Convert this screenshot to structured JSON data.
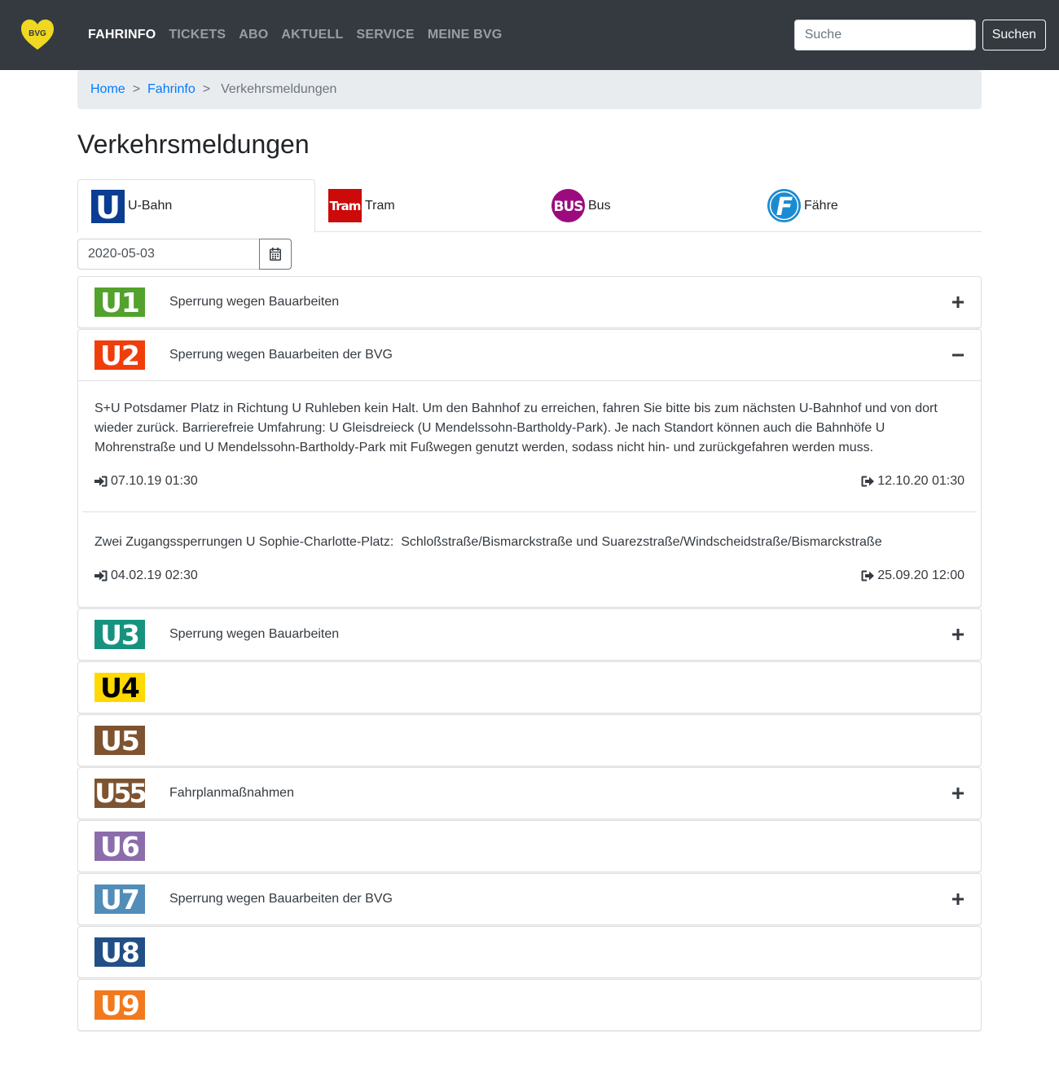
{
  "navbar": {
    "logo_text": "BVG",
    "items": [
      {
        "label": "FAHRINFO",
        "active": true
      },
      {
        "label": "TICKETS",
        "active": false
      },
      {
        "label": "ABO",
        "active": false
      },
      {
        "label": "AKTUELL",
        "active": false
      },
      {
        "label": "SERVICE",
        "active": false
      },
      {
        "label": "MEINE BVG",
        "active": false
      }
    ],
    "search_placeholder": "Suche",
    "search_button": "Suchen"
  },
  "breadcrumb": {
    "items": [
      "Home",
      "Fahrinfo"
    ],
    "separator": ">",
    "current": "Verkehrsmeldungen"
  },
  "page_title": "Verkehrsmeldungen",
  "tabs": [
    {
      "icon_text": "U",
      "label": "U-Bahn",
      "active": true
    },
    {
      "icon_text": "Tram",
      "label": "Tram",
      "active": false
    },
    {
      "icon_text": "BUS",
      "label": "Bus",
      "active": false
    },
    {
      "icon_text": "F",
      "label": "Fähre",
      "active": false
    }
  ],
  "date_value": "2020-05-03",
  "lines": [
    {
      "name": "U1",
      "color": "#52a22d",
      "text_color": "#ffffff",
      "title": "Sperrung wegen Bauarbeiten",
      "toggle": "plus"
    },
    {
      "name": "U2",
      "color": "#f03e0b",
      "text_color": "#ffffff",
      "title": "Sperrung wegen Bauarbeiten der BVG",
      "toggle": "minus",
      "messages": [
        {
          "text": "S+U Potsdamer Platz in Richtung U Ruhleben kein Halt. Um den Bahnhof zu erreichen, fahren Sie bitte bis zum nächsten U-Bahnhof und von dort wieder zurück. Barrierefreie Umfahrung: U Gleisdreieck (U Mendelssohn-Bartholdy-Park). Je nach Standort können auch die Bahnhöfe U Mohrenstraße und U Mendelssohn-Bartholdy-Park mit Fußwegen genutzt werden, sodass nicht hin- und zurückgefahren werden muss.",
          "start": "07.10.19 01:30",
          "end": "12.10.20 01:30"
        },
        {
          "text": "Zwei Zugangssperrungen U Sophie-Charlotte-Platz:  Schloßstraße/Bismarckstraße und Suarezstraße/Windscheidstraße/Bismarckstraße",
          "start": "04.02.19 02:30",
          "end": "25.09.20 12:00"
        }
      ]
    },
    {
      "name": "U3",
      "color": "#16937e",
      "text_color": "#ffffff",
      "title": "Sperrung wegen Bauarbeiten",
      "toggle": "plus"
    },
    {
      "name": "U4",
      "color": "#ffd900",
      "text_color": "#000000",
      "title": "",
      "toggle": "none"
    },
    {
      "name": "U5",
      "color": "#7e5330",
      "text_color": "#ffffff",
      "title": "",
      "toggle": "none"
    },
    {
      "name": "U55",
      "color": "#7e5330",
      "text_color": "#ffffff",
      "title": "Fahrplanmaßnahmen",
      "toggle": "plus"
    },
    {
      "name": "U6",
      "color": "#8c6dab",
      "text_color": "#ffffff",
      "title": "",
      "toggle": "none"
    },
    {
      "name": "U7",
      "color": "#528dba",
      "text_color": "#ffffff",
      "title": "Sperrung wegen Bauarbeiten der BVG",
      "toggle": "plus"
    },
    {
      "name": "U8",
      "color": "#224f86",
      "text_color": "#ffffff",
      "title": "",
      "toggle": "none"
    },
    {
      "name": "U9",
      "color": "#f3791d",
      "text_color": "#ffffff",
      "title": "",
      "toggle": "none"
    }
  ]
}
